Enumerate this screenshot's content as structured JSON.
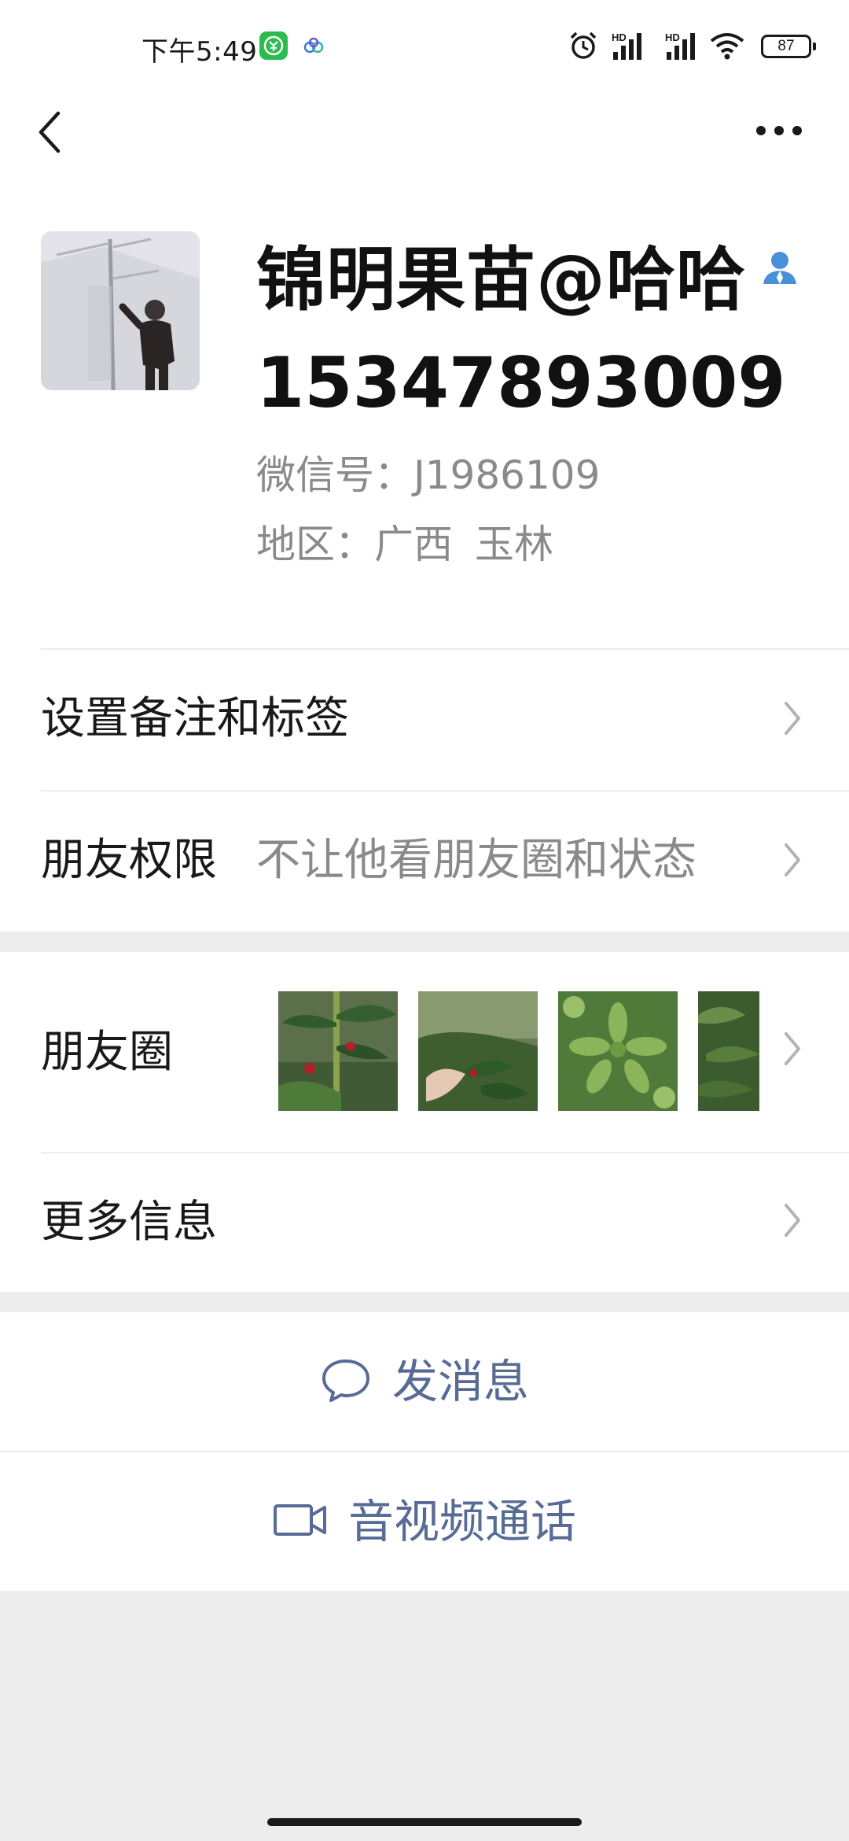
{
  "status_bar": {
    "time": "下午5:49",
    "network_label_1": "HD",
    "network_label_2": "HD",
    "battery": "87"
  },
  "profile": {
    "name": "锦明果苗@哈哈",
    "phone": "15347893009",
    "wechat_id": "微信号：J1986109",
    "region_label": "地区：",
    "region_province": "广西",
    "region_city": "玉林"
  },
  "rows": {
    "remark_label": "设置备注和标签",
    "permission_label": "朋友权限",
    "permission_value": "不让他看朋友圈和状态",
    "moments_label": "朋友圈",
    "more_info_label": "更多信息"
  },
  "actions": {
    "message_label": "发消息",
    "call_label": "音视频通话"
  },
  "colors": {
    "link": "#576b95",
    "secondary_text": "#8a8a8a",
    "background": "#ededed"
  }
}
